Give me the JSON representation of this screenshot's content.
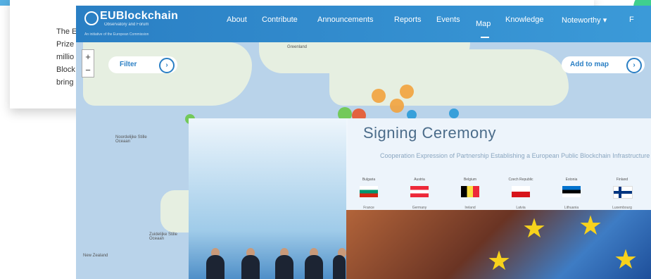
{
  "article": {
    "lines": [
      "The E",
      "Prize",
      "millio",
      "Block",
      "bring"
    ]
  },
  "site": {
    "logo": "EUBlockchain",
    "logo_sub": "Observatory and Forum",
    "logo_sub2": "An initiative of the European Commission"
  },
  "nav": {
    "items": [
      "About",
      "Contribute",
      "Announcements",
      "Reports",
      "Events",
      "Map",
      "Knowledge",
      "Noteworthy ▾",
      "F"
    ]
  },
  "map": {
    "filter_label": "Filter",
    "add_label": "Add to map",
    "zoom_in": "+",
    "zoom_out": "−",
    "labels": {
      "greenland": "Greenland",
      "north_atlantic": "Noordelijke Stille Oceaan",
      "south_pacific": "Zuidelijke Stille Oceaan",
      "new_zealand": "New Zealand"
    }
  },
  "ceremony": {
    "title": "Signing Ceremony",
    "subtitle": "Cooperation Expression of Partnership Establishing a European Public Blockchain Infrastructure",
    "countries": [
      "Bulgaria",
      "Austria",
      "Belgium",
      "Czech Republic",
      "Estonia",
      "Finland"
    ],
    "countries_row2": [
      "France",
      "Germany",
      "Ireland",
      "Latvia",
      "Lithuania",
      "Luxembourg"
    ]
  },
  "colors": {
    "nav_blue": "#2a7fc4",
    "accent_green": "#3fcf8e",
    "cluster_orange": "#f2a23d"
  }
}
